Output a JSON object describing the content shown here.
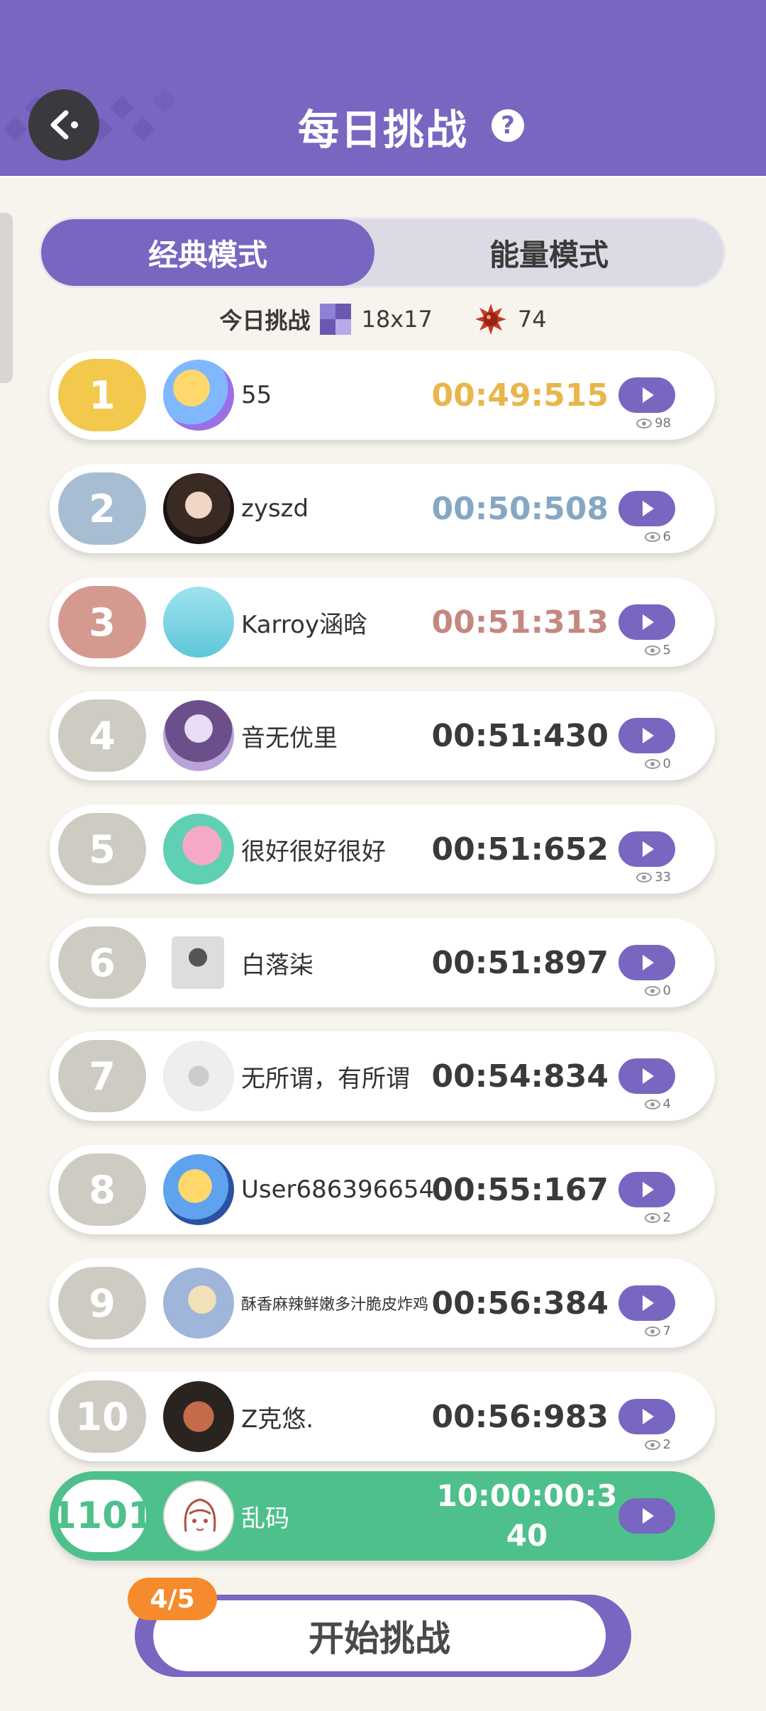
{
  "header": {
    "title": "每日挑战"
  },
  "tabs": {
    "classic": "经典模式",
    "energy": "能量模式"
  },
  "info": {
    "label": "今日挑战",
    "size": "18x17",
    "mines": "74"
  },
  "rows": [
    {
      "rank": "1",
      "name": "55",
      "time": "00:49:515",
      "views": "98",
      "rank_color": "#f2c94c",
      "time_color": "#e8b64a"
    },
    {
      "rank": "2",
      "name": "zyszd",
      "time": "00:50:508",
      "views": "6",
      "rank_color": "#a7bdd2",
      "time_color": "#86a7c4"
    },
    {
      "rank": "3",
      "name": "Karroy涵晗",
      "time": "00:51:313",
      "views": "5",
      "rank_color": "#d49a90",
      "time_color": "#c48880"
    },
    {
      "rank": "4",
      "name": "音无优里",
      "time": "00:51:430",
      "views": "0",
      "rank_color": "#cdcbc2",
      "time_color": "#3a3a3a"
    },
    {
      "rank": "5",
      "name": "很好很好很好",
      "time": "00:51:652",
      "views": "33",
      "rank_color": "#cdcbc2",
      "time_color": "#3a3a3a"
    },
    {
      "rank": "6",
      "name": "白落柒",
      "time": "00:51:897",
      "views": "0",
      "rank_color": "#cdcbc2",
      "time_color": "#3a3a3a"
    },
    {
      "rank": "7",
      "name": "无所谓，有所谓",
      "time": "00:54:834",
      "views": "4",
      "rank_color": "#cdcbc2",
      "time_color": "#3a3a3a"
    },
    {
      "rank": "8",
      "name": "User686396654",
      "time": "00:55:167",
      "views": "2",
      "rank_color": "#cdcbc2",
      "time_color": "#3a3a3a"
    },
    {
      "rank": "9",
      "name": "酥香麻辣鲜嫩多汁脆皮炸鸡",
      "time": "00:56:384",
      "views": "7",
      "rank_color": "#cdcbc2",
      "time_color": "#3a3a3a"
    },
    {
      "rank": "10",
      "name": "Z克悠.",
      "time": "00:56:983",
      "views": "2",
      "rank_color": "#cdcbc2",
      "time_color": "#3a3a3a"
    }
  ],
  "me": {
    "rank": "1101",
    "name": "乱码",
    "time_line1": "10:00:00:3",
    "time_line2": "40"
  },
  "start": {
    "label": "开始挑战",
    "attempts": "4/5"
  },
  "colors": {
    "primary": "#7866c1",
    "me": "#4ec08c",
    "counter": "#f58b2c"
  }
}
